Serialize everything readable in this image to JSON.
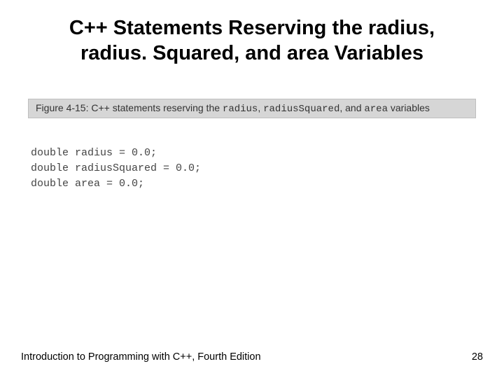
{
  "title": "C++ Statements Reserving the radius, radius. Squared, and area Variables",
  "figure": {
    "label_prefix": "Figure 4-15: C++ statements reserving the ",
    "var1": "radius",
    "sep1": ", ",
    "var2": "radiusSquared",
    "sep2": ", and ",
    "var3": "area",
    "label_suffix": " variables"
  },
  "code": {
    "line1": "double radius = 0.0;",
    "line2": "double radiusSquared = 0.0;",
    "line3": "double area = 0.0;"
  },
  "footer": {
    "left": "Introduction to Programming with C++, Fourth Edition",
    "right": "28"
  }
}
